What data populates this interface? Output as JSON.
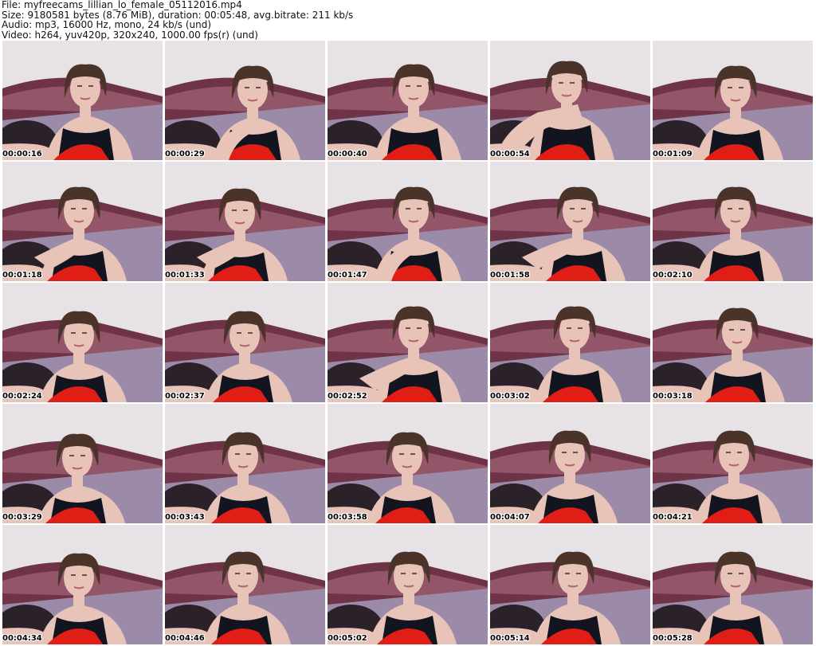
{
  "header": {
    "file_line": "File: myfreecams_lillian_lo_female_05112016.mp4",
    "size_line": "Size: 9180581 bytes (8.76 MiB), duration: 00:05:48, avg.bitrate: 211 kb/s",
    "audio_line": "Audio: mp3, 16000 Hz, mono, 24 kb/s (und)",
    "video_line": "Video: h264, yuv420p, 320x240, 1000.00 fps(r) (und)"
  },
  "colors": {
    "wall": "#e6e2e6",
    "sofa": "#9b8aa8",
    "sofa_back": "#6e3346",
    "skin": "#e8c3b8",
    "hair": "#4a3328",
    "top": "#121420",
    "pillow": "#e01e16",
    "timestamp_text": "#000000",
    "timestamp_outline": "#ffffff"
  },
  "thumbnails": [
    {
      "timestamp": "00:00:16"
    },
    {
      "timestamp": "00:00:29"
    },
    {
      "timestamp": "00:00:40"
    },
    {
      "timestamp": "00:00:54"
    },
    {
      "timestamp": "00:01:09"
    },
    {
      "timestamp": "00:01:18"
    },
    {
      "timestamp": "00:01:33"
    },
    {
      "timestamp": "00:01:47"
    },
    {
      "timestamp": "00:01:58"
    },
    {
      "timestamp": "00:02:10"
    },
    {
      "timestamp": "00:02:24"
    },
    {
      "timestamp": "00:02:37"
    },
    {
      "timestamp": "00:02:52"
    },
    {
      "timestamp": "00:03:02"
    },
    {
      "timestamp": "00:03:18"
    },
    {
      "timestamp": "00:03:29"
    },
    {
      "timestamp": "00:03:43"
    },
    {
      "timestamp": "00:03:58"
    },
    {
      "timestamp": "00:04:07"
    },
    {
      "timestamp": "00:04:21"
    },
    {
      "timestamp": "00:04:34"
    },
    {
      "timestamp": "00:04:46"
    },
    {
      "timestamp": "00:05:02"
    },
    {
      "timestamp": "00:05:14"
    },
    {
      "timestamp": "00:05:28"
    }
  ]
}
